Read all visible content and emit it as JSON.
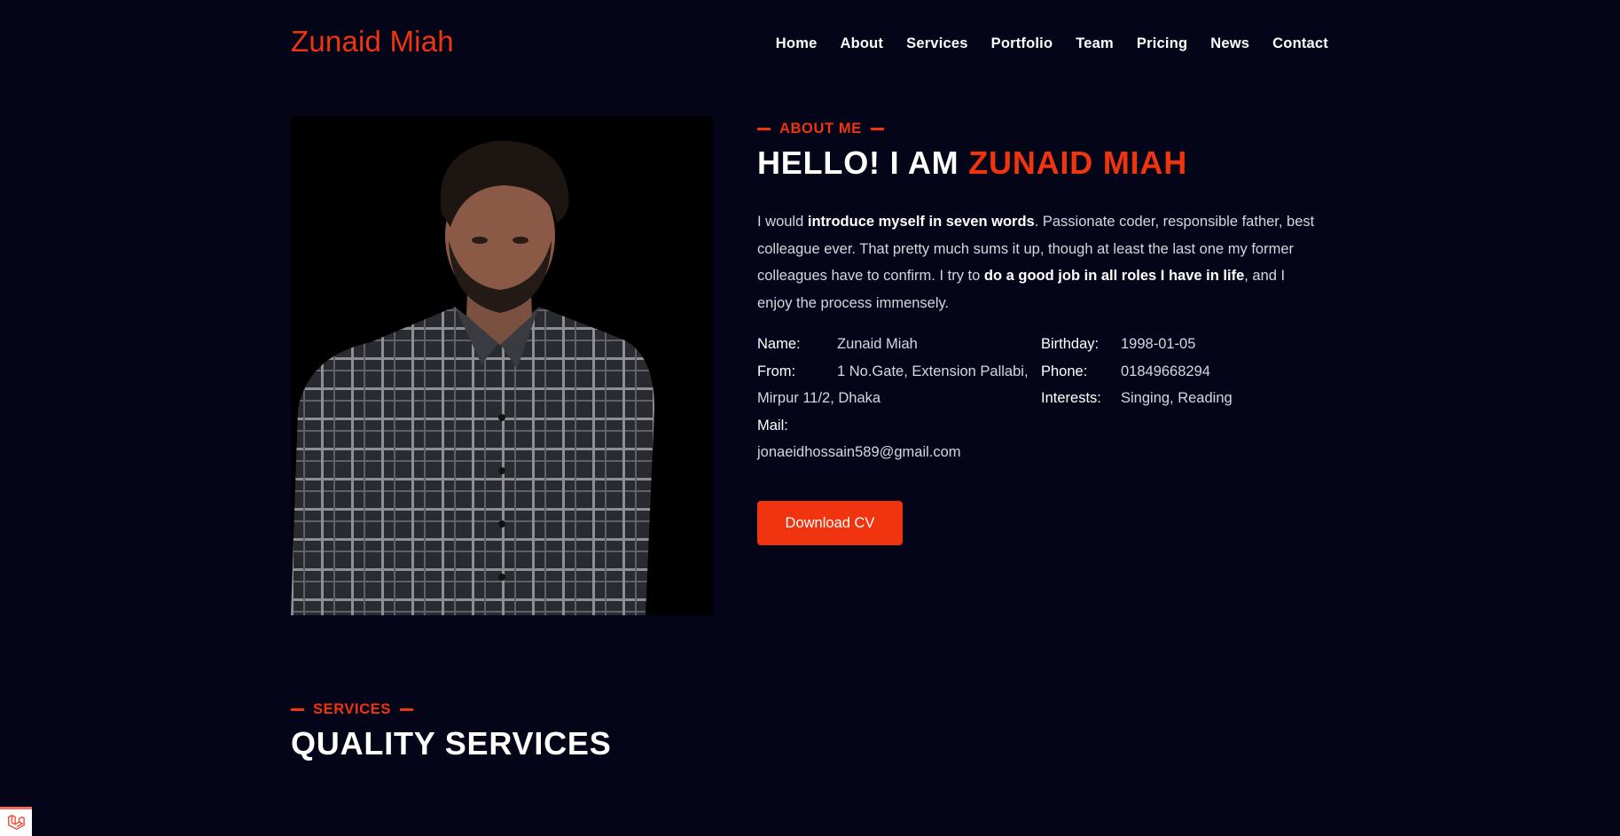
{
  "brand": "Zunaid Miah",
  "nav": [
    "Home",
    "About",
    "Services",
    "Portfolio",
    "Team",
    "Pricing",
    "News",
    "Contact"
  ],
  "about": {
    "eyebrow": "ABOUT ME",
    "headline_prefix": "HELLO! I AM",
    "headline_name": "ZUNAID MIAH",
    "bio": {
      "p1": "I would ",
      "b1": "introduce myself in seven words",
      "p2": ". Passionate coder, responsible father, best colleague ever. That pretty much sums it up, though at least the last one my former colleagues have to confirm. I try to ",
      "b2": "do a good job in all roles I have in life",
      "p3": ", and I enjoy the process immensely."
    },
    "info_left": {
      "name_label": "Name:",
      "name_value": "Zunaid Miah",
      "from_label": "From:",
      "from_value": "1 No.Gate, Extension Pallabi,",
      "from_value_2": "Mirpur 11/2, Dhaka",
      "mail_label": "Mail:",
      "mail_value": "jonaeidhossain589@gmail.com"
    },
    "info_right": {
      "birthday_label": "Birthday:",
      "birthday_value": "1998-01-05",
      "phone_label": "Phone:",
      "phone_value": "01849668294",
      "interests_label": "Interests:",
      "interests_value": "Singing, Reading"
    },
    "download_label": "Download CV"
  },
  "services": {
    "eyebrow": "SERVICES",
    "headline": "QUALITY SERVICES"
  },
  "colors": {
    "accent": "#f0340f",
    "background": "#05051a"
  },
  "icons": {
    "corner": "laravel-icon"
  }
}
